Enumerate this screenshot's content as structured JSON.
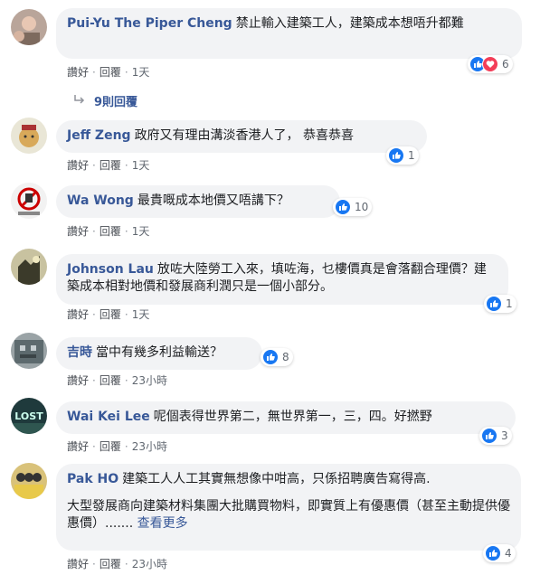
{
  "comments": [
    {
      "author": "Pui-Yu The Piper Cheng",
      "text": "禁止輸入建築工人，建築成本想唔升都難",
      "like_label": "讚好",
      "reply_label": "回覆",
      "time": "1天",
      "reaction_count": "6",
      "replies_label": "9則回覆"
    },
    {
      "author": "Jeff Zeng",
      "text": "政府又有理由溝淡香港人了， 恭喜恭喜",
      "like_label": "讚好",
      "reply_label": "回覆",
      "time": "1天",
      "reaction_count": "1"
    },
    {
      "author": "Wa Wong",
      "text": "最貴嘅成本地價又唔講下？",
      "like_label": "讚好",
      "reply_label": "回覆",
      "time": "1天",
      "reaction_count": "10"
    },
    {
      "author": "Johnson Lau",
      "text": "放咗大陸勞工入來，填咗海，乜樓價真是會落翻合理價？建築成本相對地價和發展商利潤只是一個小部分。",
      "like_label": "讚好",
      "reply_label": "回覆",
      "time": "1天",
      "reaction_count": "1"
    },
    {
      "author": "吉時",
      "text": "當中有幾多利益輸送？",
      "like_label": "讚好",
      "reply_label": "回覆",
      "time": "23小時",
      "reaction_count": "8"
    },
    {
      "author": "Wai Kei Lee",
      "text": "呢個表得世界第二，無世界第一，三，四。好撚野",
      "like_label": "讚好",
      "reply_label": "回覆",
      "time": "23小時",
      "reaction_count": "3"
    },
    {
      "author": "Pak HO",
      "text": "建築工人人工其實無想像中咁高，只係招聘廣告寫得高.",
      "text2": "大型發展商向建築材料集團大批購買物料，即實質上有優惠價（甚至主動提供優惠價）.......",
      "see_more": "查看更多",
      "like_label": "讚好",
      "reply_label": "回覆",
      "time": "23小時",
      "reaction_count": "4"
    }
  ],
  "colors": {
    "link_blue": "#385898",
    "like_blue": "#1877f2",
    "love_red": "#f33e58",
    "bubble_bg": "#f2f3f5"
  },
  "icons": {
    "like": "thumbs-up-icon",
    "love": "heart-icon",
    "reply_arrow": "reply-arrow-icon"
  }
}
